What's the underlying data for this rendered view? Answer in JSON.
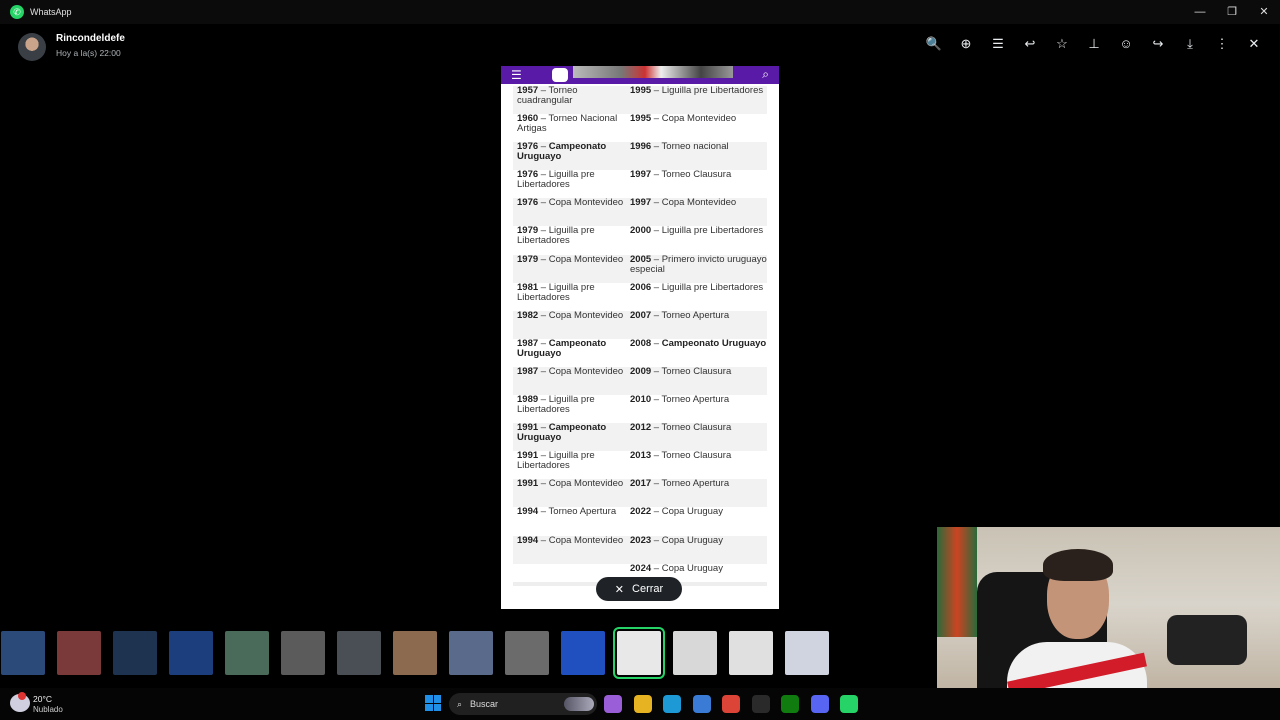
{
  "window": {
    "title": "WhatsApp",
    "controls": [
      "—",
      "❐",
      "✕"
    ]
  },
  "viewer": {
    "sender": "Rincondeldefe",
    "time": "Hoy a la(s) 22:00",
    "tools": [
      {
        "icon": "zoom-out-icon",
        "glyph": "🔍"
      },
      {
        "icon": "zoom-in-icon",
        "glyph": "⊕"
      },
      {
        "icon": "text-icon",
        "glyph": "☰"
      },
      {
        "icon": "reply-icon",
        "glyph": "↩"
      },
      {
        "icon": "star-icon",
        "glyph": "☆"
      },
      {
        "icon": "pin-icon",
        "glyph": "⊥"
      },
      {
        "icon": "emoji-icon",
        "glyph": "☺"
      },
      {
        "icon": "forward-icon",
        "glyph": "↪"
      },
      {
        "icon": "download-icon",
        "glyph": "⤓"
      },
      {
        "icon": "more-icon",
        "glyph": "⋮"
      },
      {
        "icon": "close-icon",
        "glyph": "✕"
      }
    ],
    "close_label": "Cerrar"
  },
  "document": {
    "rows": [
      {
        "l_year": "1957",
        "l_text": "Torneo cuadrangular",
        "l_bold": false,
        "r_year": "1995",
        "r_text": "Liguilla pre Libertadores",
        "r_bold": false
      },
      {
        "l_year": "1960",
        "l_text": "Torneo Nacional Artigas",
        "l_bold": false,
        "r_year": "1995",
        "r_text": "Copa Montevideo",
        "r_bold": false
      },
      {
        "l_year": "1976",
        "l_text": "Campeonato Uruguayo",
        "l_bold": true,
        "r_year": "1996",
        "r_text": "Torneo nacional",
        "r_bold": false
      },
      {
        "l_year": "1976",
        "l_text": "Liguilla pre Libertadores",
        "l_bold": false,
        "r_year": "1997",
        "r_text": "Torneo Clausura",
        "r_bold": false
      },
      {
        "l_year": "1976",
        "l_text": "Copa Montevideo",
        "l_bold": false,
        "r_year": "1997",
        "r_text": "Copa Montevideo",
        "r_bold": false
      },
      {
        "l_year": "1979",
        "l_text": "Liguilla pre Libertadores",
        "l_bold": false,
        "r_year": "2000",
        "r_text": "Liguilla pre Libertadores",
        "r_bold": false
      },
      {
        "l_year": "1979",
        "l_text": "Copa Montevideo",
        "l_bold": false,
        "r_year": "2005",
        "r_text": "Primero invicto uruguayo especial",
        "r_bold": false
      },
      {
        "l_year": "1981",
        "l_text": "Liguilla pre Libertadores",
        "l_bold": false,
        "r_year": "2006",
        "r_text": "Liguilla pre Libertadores",
        "r_bold": false
      },
      {
        "l_year": "1982",
        "l_text": "Copa Montevideo",
        "l_bold": false,
        "r_year": "2007",
        "r_text": "Torneo Apertura",
        "r_bold": false
      },
      {
        "l_year": "1987",
        "l_text": "Campeonato Uruguayo",
        "l_bold": true,
        "r_year": "2008",
        "r_text": "Campeonato Uruguayo",
        "r_bold": true
      },
      {
        "l_year": "1987",
        "l_text": "Copa Montevideo",
        "l_bold": false,
        "r_year": "2009",
        "r_text": "Torneo Clausura",
        "r_bold": false
      },
      {
        "l_year": "1989",
        "l_text": "Liguilla pre Libertadores",
        "l_bold": false,
        "r_year": "2010",
        "r_text": "Torneo Apertura",
        "r_bold": false
      },
      {
        "l_year": "1991",
        "l_text": "Campeonato Uruguayo",
        "l_bold": true,
        "r_year": "2012",
        "r_text": "Torneo Clausura",
        "r_bold": false
      },
      {
        "l_year": "1991",
        "l_text": "Liguilla pre Libertadores",
        "l_bold": false,
        "r_year": "2013",
        "r_text": "Torneo Clausura",
        "r_bold": false
      },
      {
        "l_year": "1991",
        "l_text": "Copa Montevideo",
        "l_bold": false,
        "r_year": "2017",
        "r_text": "Torneo Apertura",
        "r_bold": false
      },
      {
        "l_year": "1994",
        "l_text": "Torneo Apertura",
        "l_bold": false,
        "r_year": "2022",
        "r_text": "Copa Uruguay",
        "r_bold": false
      },
      {
        "l_year": "1994",
        "l_text": "Copa Montevideo",
        "l_bold": false,
        "r_year": "2023",
        "r_text": "Copa Uruguay",
        "r_bold": false
      },
      {
        "l_year": "",
        "l_text": "",
        "l_bold": false,
        "r_year": "2024",
        "r_text": "Copa Uruguay",
        "r_bold": false
      }
    ]
  },
  "thumbnails": {
    "colors": [
      "#2b4a7a",
      "#7a3a3a",
      "#1e3350",
      "#1d3e7d",
      "#4a6a5a",
      "#5b5b5b",
      "#4a4f55",
      "#8c6a50",
      "#5a6a8a",
      "#6b6b6b",
      "#2050c0",
      "#e8e8e8",
      "#d8d8d8",
      "#e0e0e0",
      "#d0d4e0"
    ],
    "active_index": 11
  },
  "taskbar": {
    "temp": "20°C",
    "condition": "Nublado",
    "search_label": "Buscar",
    "icons": [
      {
        "name": "copilot-icon",
        "color": "#9a5fd8"
      },
      {
        "name": "file-explorer-icon",
        "color": "#e6b422"
      },
      {
        "name": "edge-icon",
        "color": "#1d9ad6"
      },
      {
        "name": "store-icon",
        "color": "#3a7bd5"
      },
      {
        "name": "chrome-icon",
        "color": "#db4437"
      },
      {
        "name": "steam-icon",
        "color": "#2a2a2a"
      },
      {
        "name": "xbox-icon",
        "color": "#107c10"
      },
      {
        "name": "discord-icon",
        "color": "#5865f2"
      },
      {
        "name": "whatsapp-icon",
        "color": "#25d366"
      }
    ]
  }
}
